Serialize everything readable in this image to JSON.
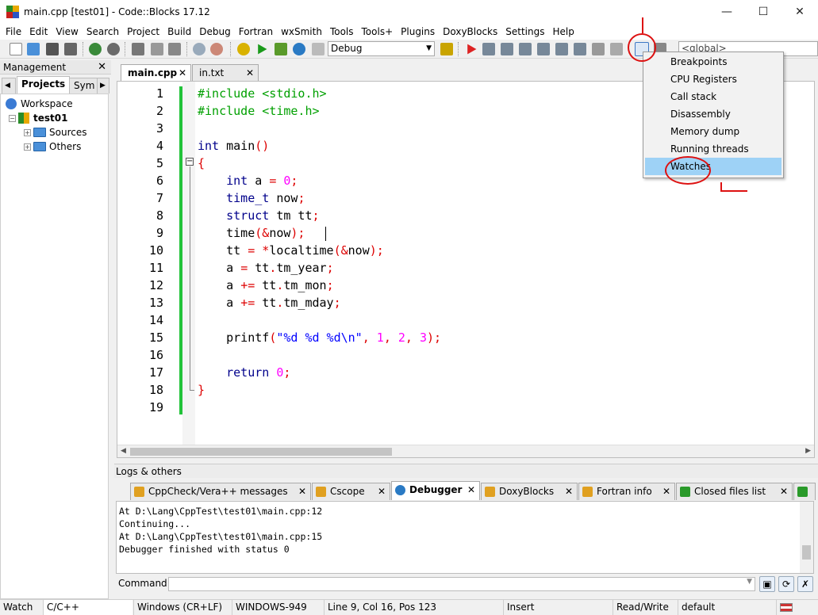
{
  "window": {
    "title": "main.cpp [test01] - Code::Blocks 17.12",
    "minimize": "—",
    "maximize": "☐",
    "close": "✕"
  },
  "menu": [
    "File",
    "Edit",
    "View",
    "Search",
    "Project",
    "Build",
    "Debug",
    "Fortran",
    "wxSmith",
    "Tools",
    "Tools+",
    "Plugins",
    "DoxyBlocks",
    "Settings",
    "Help"
  ],
  "toolbar": {
    "build_target": "Debug",
    "scope": "<global>"
  },
  "management": {
    "title": "Management",
    "tabs": [
      "Projects",
      "Sym"
    ],
    "tree": {
      "workspace": "Workspace",
      "project": "test01",
      "folders": [
        "Sources",
        "Others"
      ]
    }
  },
  "editor": {
    "tabs": [
      "main.cpp",
      "in.txt"
    ],
    "line_numbers": [
      "1",
      "2",
      "3",
      "4",
      "5",
      "6",
      "7",
      "8",
      "9",
      "10",
      "11",
      "12",
      "13",
      "14",
      "15",
      "16",
      "17",
      "18",
      "19"
    ],
    "code": [
      [
        [
          "pp",
          "#include <stdio.h>"
        ]
      ],
      [
        [
          "pp",
          "#include <time.h>"
        ]
      ],
      [],
      [
        [
          "kw",
          "int"
        ],
        [
          "tx",
          " main"
        ],
        [
          "op",
          "()"
        ]
      ],
      [
        [
          "op",
          "{"
        ]
      ],
      [
        [
          "tx",
          "    "
        ],
        [
          "kw",
          "int"
        ],
        [
          "tx",
          " a "
        ],
        [
          "op",
          "="
        ],
        [
          "tx",
          " "
        ],
        [
          "num",
          "0"
        ],
        [
          "op",
          ";"
        ]
      ],
      [
        [
          "tx",
          "    "
        ],
        [
          "kw",
          "time_t"
        ],
        [
          "tx",
          " now"
        ],
        [
          "op",
          ";"
        ]
      ],
      [
        [
          "tx",
          "    "
        ],
        [
          "kw",
          "struct"
        ],
        [
          "tx",
          " tm tt"
        ],
        [
          "op",
          ";"
        ]
      ],
      [
        [
          "tx",
          "    time"
        ],
        [
          "op",
          "(&"
        ],
        [
          "tx",
          "now"
        ],
        [
          "op",
          ");"
        ]
      ],
      [
        [
          "tx",
          "    tt "
        ],
        [
          "op",
          "= *"
        ],
        [
          "tx",
          "localtime"
        ],
        [
          "op",
          "(&"
        ],
        [
          "tx",
          "now"
        ],
        [
          "op",
          ");"
        ]
      ],
      [
        [
          "tx",
          "    a "
        ],
        [
          "op",
          "="
        ],
        [
          "tx",
          " tt"
        ],
        [
          "op",
          "."
        ],
        [
          "tx",
          "tm_year"
        ],
        [
          "op",
          ";"
        ]
      ],
      [
        [
          "tx",
          "    a "
        ],
        [
          "op",
          "+="
        ],
        [
          "tx",
          " tt"
        ],
        [
          "op",
          "."
        ],
        [
          "tx",
          "tm_mon"
        ],
        [
          "op",
          ";"
        ]
      ],
      [
        [
          "tx",
          "    a "
        ],
        [
          "op",
          "+="
        ],
        [
          "tx",
          " tt"
        ],
        [
          "op",
          "."
        ],
        [
          "tx",
          "tm_mday"
        ],
        [
          "op",
          ";"
        ]
      ],
      [],
      [
        [
          "tx",
          "    printf"
        ],
        [
          "op",
          "("
        ],
        [
          "str",
          "\"%d %d %d\\n\""
        ],
        [
          "op",
          ", "
        ],
        [
          "num",
          "1"
        ],
        [
          "op",
          ", "
        ],
        [
          "num",
          "2"
        ],
        [
          "op",
          ", "
        ],
        [
          "num",
          "3"
        ],
        [
          "op",
          ");"
        ]
      ],
      [],
      [
        [
          "tx",
          "    "
        ],
        [
          "kw",
          "return"
        ],
        [
          "tx",
          " "
        ],
        [
          "num",
          "0"
        ],
        [
          "op",
          ";"
        ]
      ],
      [
        [
          "op",
          "}"
        ]
      ],
      []
    ]
  },
  "logs": {
    "title": "Logs & others",
    "tabs": [
      "CppCheck/Vera++ messages",
      "Cscope",
      "Debugger",
      "DoxyBlocks",
      "Fortran info",
      "Closed files list"
    ],
    "lines": [
      "At D:\\Lang\\CppTest\\test01\\main.cpp:12",
      "Continuing...",
      "At D:\\Lang\\CppTest\\test01\\main.cpp:15",
      "Debugger finished with status 0"
    ],
    "command_label": "Command:"
  },
  "debug_menu": {
    "items": [
      "Breakpoints",
      "CPU Registers",
      "Call stack",
      "Disassembly",
      "Memory dump",
      "Running threads",
      "Watches"
    ],
    "highlighted": "Watches"
  },
  "status": {
    "left": "Watch vai",
    "language": "C/C++",
    "eol": "Windows (CR+LF)",
    "encoding": "WINDOWS-949",
    "position": "Line 9, Col 16, Pos 123",
    "mode": "Insert",
    "access": "Read/Write",
    "profile": "default"
  },
  "colors": {
    "annotation": "#d11111",
    "highlight": "#9ed2f6",
    "changebar": "#22c33a"
  }
}
